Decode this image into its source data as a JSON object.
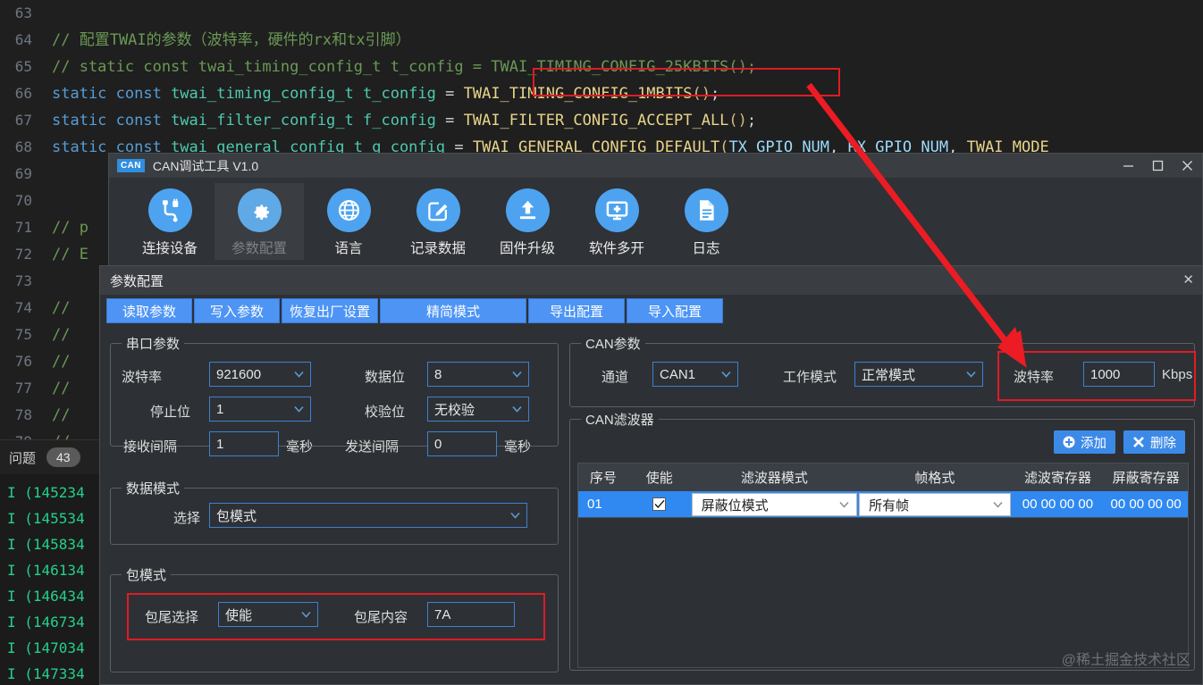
{
  "editor": {
    "lines": [
      {
        "num": "63",
        "segments": []
      },
      {
        "num": "64",
        "segments": [
          {
            "t": "// 配置TWAI的参数（波特率，硬件的rx和tx引脚）",
            "c": "tok-cmt"
          }
        ]
      },
      {
        "num": "65",
        "segments": [
          {
            "t": "// static const twai_timing_config_t t_config = TWAI_TIMING_CONFIG_25KBITS();",
            "c": "tok-cmt"
          }
        ]
      },
      {
        "num": "66",
        "segments": [
          {
            "t": "static const ",
            "c": "tok-kw"
          },
          {
            "t": "twai_timing_config_t ",
            "c": "tok-typ"
          },
          {
            "t": "t_config ",
            "c": "tok-typ"
          },
          {
            "t": "= ",
            "c": "tok-pun"
          },
          {
            "t": "TWAI_TIMING_CONFIG_1MBITS",
            "c": "tok-yel"
          },
          {
            "t": "()",
            "c": "tok-org"
          },
          {
            "t": ";",
            "c": "tok-pun"
          }
        ]
      },
      {
        "num": "67",
        "segments": [
          {
            "t": "static const ",
            "c": "tok-kw"
          },
          {
            "t": "twai_filter_config_t ",
            "c": "tok-typ"
          },
          {
            "t": "f_config ",
            "c": "tok-typ"
          },
          {
            "t": "= ",
            "c": "tok-pun"
          },
          {
            "t": "TWAI_FILTER_CONFIG_ACCEPT_ALL",
            "c": "tok-yel"
          },
          {
            "t": "()",
            "c": "tok-org"
          },
          {
            "t": ";",
            "c": "tok-pun"
          }
        ]
      },
      {
        "num": "68",
        "segments": [
          {
            "t": "static const ",
            "c": "tok-kw"
          },
          {
            "t": "twai_general_config_t ",
            "c": "tok-typ"
          },
          {
            "t": "g_config ",
            "c": "tok-typ"
          },
          {
            "t": "= ",
            "c": "tok-pun"
          },
          {
            "t": "TWAI_GENERAL_CONFIG_DEFAULT",
            "c": "tok-yel"
          },
          {
            "t": "(",
            "c": "tok-org"
          },
          {
            "t": "TX_GPIO_NUM",
            "c": "tok-var"
          },
          {
            "t": ", ",
            "c": "tok-pun"
          },
          {
            "t": "RX_GPIO_NUM",
            "c": "tok-var"
          },
          {
            "t": ", ",
            "c": "tok-pun"
          },
          {
            "t": "TWAI_MODE_",
            "c": "tok-yel"
          }
        ]
      },
      {
        "num": "69",
        "segments": []
      },
      {
        "num": "70",
        "segments": []
      },
      {
        "num": "71",
        "segments": [
          {
            "t": "// p",
            "c": "tok-cmt"
          }
        ]
      },
      {
        "num": "72",
        "segments": [
          {
            "t": "// E",
            "c": "tok-cmt"
          }
        ]
      },
      {
        "num": "73",
        "segments": []
      },
      {
        "num": "74",
        "segments": [
          {
            "t": "//",
            "c": "tok-cmt"
          }
        ]
      },
      {
        "num": "75",
        "segments": [
          {
            "t": "//",
            "c": "tok-cmt"
          }
        ]
      },
      {
        "num": "76",
        "segments": [
          {
            "t": "//",
            "c": "tok-cmt"
          }
        ]
      },
      {
        "num": "77",
        "segments": [
          {
            "t": "//",
            "c": "tok-cmt"
          }
        ]
      },
      {
        "num": "78",
        "segments": [
          {
            "t": "//",
            "c": "tok-cmt"
          }
        ]
      },
      {
        "num": "79",
        "segments": [
          {
            "t": "//",
            "c": "tok-cmt"
          }
        ]
      }
    ]
  },
  "panel": {
    "tab_label": "问题",
    "badge": "43",
    "terminal_lines": [
      "I (145234",
      "I (145534",
      "I (145834",
      "I (146134",
      "I (146434",
      "I (146734",
      "I (147034",
      "I (147334"
    ]
  },
  "can_window": {
    "logo_text": "CAN",
    "title": "CAN调试工具 V1.0",
    "toolbar": [
      {
        "label": "连接设备",
        "icon": "usb-cable-icon",
        "active": false
      },
      {
        "label": "参数配置",
        "icon": "gear-icon",
        "active": true
      },
      {
        "label": "语言",
        "icon": "globe-icon",
        "active": false
      },
      {
        "label": "记录数据",
        "icon": "pencil-note-icon",
        "active": false
      },
      {
        "label": "固件升级",
        "icon": "upload-icon",
        "active": false
      },
      {
        "label": "软件多开",
        "icon": "monitor-plus-icon",
        "active": false
      },
      {
        "label": "日志",
        "icon": "document-lines-icon",
        "active": false
      }
    ],
    "window_controls": {
      "minimize": "minimize-icon",
      "maximize": "maximize-icon",
      "close": "close-icon"
    }
  },
  "dialog": {
    "title": "参数配置",
    "close_glyph": "✕",
    "tabs": [
      "读取参数",
      "写入参数",
      "恢复出厂设置",
      "精简模式",
      "导出配置",
      "导入配置"
    ],
    "serial_group": {
      "title": "串口参数",
      "baudrate_label": "波特率",
      "baudrate_value": "921600",
      "databits_label": "数据位",
      "databits_value": "8",
      "stopbits_label": "停止位",
      "stopbits_value": "1",
      "parity_label": "校验位",
      "parity_value": "无校验",
      "rx_interval_label": "接收间隔",
      "rx_interval_value": "1",
      "rx_unit": "毫秒",
      "tx_interval_label": "发送间隔",
      "tx_interval_value": "0",
      "tx_unit": "毫秒"
    },
    "data_mode_group": {
      "title": "数据模式",
      "select_label": "选择",
      "select_value": "包模式"
    },
    "packet_mode_group": {
      "title": "包模式",
      "tail_select_label": "包尾选择",
      "tail_select_value": "使能",
      "tail_content_label": "包尾内容",
      "tail_content_value": "7A"
    },
    "can_group": {
      "title": "CAN参数",
      "channel_label": "通道",
      "channel_value": "CAN1",
      "mode_label": "工作模式",
      "mode_value": "正常模式",
      "baudrate_label": "波特率",
      "baudrate_value": "1000",
      "baudrate_unit": "Kbps"
    },
    "filter_group": {
      "title": "CAN滤波器",
      "add_label": "添加",
      "delete_label": "删除",
      "columns": [
        "序号",
        "使能",
        "滤波器模式",
        "帧格式",
        "滤波寄存器",
        "屏蔽寄存器"
      ],
      "rows": [
        {
          "index": "01",
          "enabled": true,
          "filter_mode": "屏蔽位模式",
          "frame_format": "所有帧",
          "filter_reg": "00 00 00 00",
          "mask_reg": "00 00 00 00"
        }
      ]
    }
  },
  "watermark": "@稀土掘金技术社区",
  "colors": {
    "accent_blue": "#4d94f5",
    "highlight_red": "#e01b24",
    "icon_blue": "#4da3ef"
  }
}
